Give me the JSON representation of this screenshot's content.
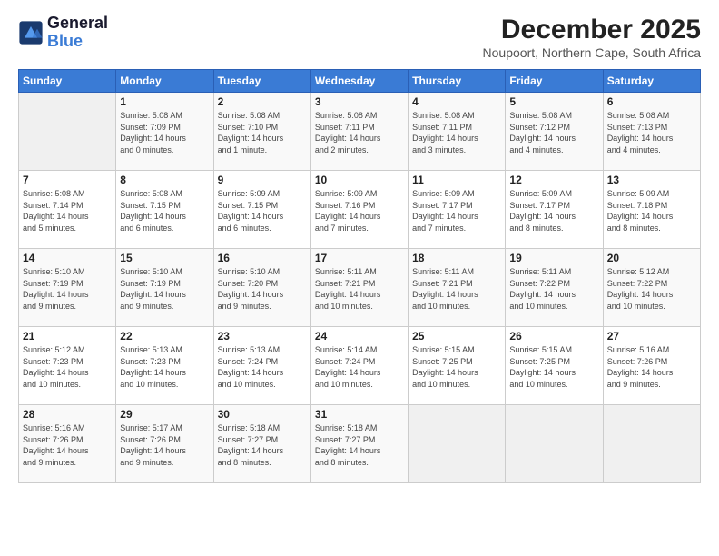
{
  "header": {
    "logo_line1": "General",
    "logo_line2": "Blue",
    "month": "December 2025",
    "location": "Noupoort, Northern Cape, South Africa"
  },
  "weekdays": [
    "Sunday",
    "Monday",
    "Tuesday",
    "Wednesday",
    "Thursday",
    "Friday",
    "Saturday"
  ],
  "weeks": [
    [
      {
        "day": "",
        "info": ""
      },
      {
        "day": "1",
        "info": "Sunrise: 5:08 AM\nSunset: 7:09 PM\nDaylight: 14 hours\nand 0 minutes."
      },
      {
        "day": "2",
        "info": "Sunrise: 5:08 AM\nSunset: 7:10 PM\nDaylight: 14 hours\nand 1 minute."
      },
      {
        "day": "3",
        "info": "Sunrise: 5:08 AM\nSunset: 7:11 PM\nDaylight: 14 hours\nand 2 minutes."
      },
      {
        "day": "4",
        "info": "Sunrise: 5:08 AM\nSunset: 7:11 PM\nDaylight: 14 hours\nand 3 minutes."
      },
      {
        "day": "5",
        "info": "Sunrise: 5:08 AM\nSunset: 7:12 PM\nDaylight: 14 hours\nand 4 minutes."
      },
      {
        "day": "6",
        "info": "Sunrise: 5:08 AM\nSunset: 7:13 PM\nDaylight: 14 hours\nand 4 minutes."
      }
    ],
    [
      {
        "day": "7",
        "info": "Sunrise: 5:08 AM\nSunset: 7:14 PM\nDaylight: 14 hours\nand 5 minutes."
      },
      {
        "day": "8",
        "info": "Sunrise: 5:08 AM\nSunset: 7:15 PM\nDaylight: 14 hours\nand 6 minutes."
      },
      {
        "day": "9",
        "info": "Sunrise: 5:09 AM\nSunset: 7:15 PM\nDaylight: 14 hours\nand 6 minutes."
      },
      {
        "day": "10",
        "info": "Sunrise: 5:09 AM\nSunset: 7:16 PM\nDaylight: 14 hours\nand 7 minutes."
      },
      {
        "day": "11",
        "info": "Sunrise: 5:09 AM\nSunset: 7:17 PM\nDaylight: 14 hours\nand 7 minutes."
      },
      {
        "day": "12",
        "info": "Sunrise: 5:09 AM\nSunset: 7:17 PM\nDaylight: 14 hours\nand 8 minutes."
      },
      {
        "day": "13",
        "info": "Sunrise: 5:09 AM\nSunset: 7:18 PM\nDaylight: 14 hours\nand 8 minutes."
      }
    ],
    [
      {
        "day": "14",
        "info": "Sunrise: 5:10 AM\nSunset: 7:19 PM\nDaylight: 14 hours\nand 9 minutes."
      },
      {
        "day": "15",
        "info": "Sunrise: 5:10 AM\nSunset: 7:19 PM\nDaylight: 14 hours\nand 9 minutes."
      },
      {
        "day": "16",
        "info": "Sunrise: 5:10 AM\nSunset: 7:20 PM\nDaylight: 14 hours\nand 9 minutes."
      },
      {
        "day": "17",
        "info": "Sunrise: 5:11 AM\nSunset: 7:21 PM\nDaylight: 14 hours\nand 10 minutes."
      },
      {
        "day": "18",
        "info": "Sunrise: 5:11 AM\nSunset: 7:21 PM\nDaylight: 14 hours\nand 10 minutes."
      },
      {
        "day": "19",
        "info": "Sunrise: 5:11 AM\nSunset: 7:22 PM\nDaylight: 14 hours\nand 10 minutes."
      },
      {
        "day": "20",
        "info": "Sunrise: 5:12 AM\nSunset: 7:22 PM\nDaylight: 14 hours\nand 10 minutes."
      }
    ],
    [
      {
        "day": "21",
        "info": "Sunrise: 5:12 AM\nSunset: 7:23 PM\nDaylight: 14 hours\nand 10 minutes."
      },
      {
        "day": "22",
        "info": "Sunrise: 5:13 AM\nSunset: 7:23 PM\nDaylight: 14 hours\nand 10 minutes."
      },
      {
        "day": "23",
        "info": "Sunrise: 5:13 AM\nSunset: 7:24 PM\nDaylight: 14 hours\nand 10 minutes."
      },
      {
        "day": "24",
        "info": "Sunrise: 5:14 AM\nSunset: 7:24 PM\nDaylight: 14 hours\nand 10 minutes."
      },
      {
        "day": "25",
        "info": "Sunrise: 5:15 AM\nSunset: 7:25 PM\nDaylight: 14 hours\nand 10 minutes."
      },
      {
        "day": "26",
        "info": "Sunrise: 5:15 AM\nSunset: 7:25 PM\nDaylight: 14 hours\nand 10 minutes."
      },
      {
        "day": "27",
        "info": "Sunrise: 5:16 AM\nSunset: 7:26 PM\nDaylight: 14 hours\nand 9 minutes."
      }
    ],
    [
      {
        "day": "28",
        "info": "Sunrise: 5:16 AM\nSunset: 7:26 PM\nDaylight: 14 hours\nand 9 minutes."
      },
      {
        "day": "29",
        "info": "Sunrise: 5:17 AM\nSunset: 7:26 PM\nDaylight: 14 hours\nand 9 minutes."
      },
      {
        "day": "30",
        "info": "Sunrise: 5:18 AM\nSunset: 7:27 PM\nDaylight: 14 hours\nand 8 minutes."
      },
      {
        "day": "31",
        "info": "Sunrise: 5:18 AM\nSunset: 7:27 PM\nDaylight: 14 hours\nand 8 minutes."
      },
      {
        "day": "",
        "info": ""
      },
      {
        "day": "",
        "info": ""
      },
      {
        "day": "",
        "info": ""
      }
    ]
  ]
}
